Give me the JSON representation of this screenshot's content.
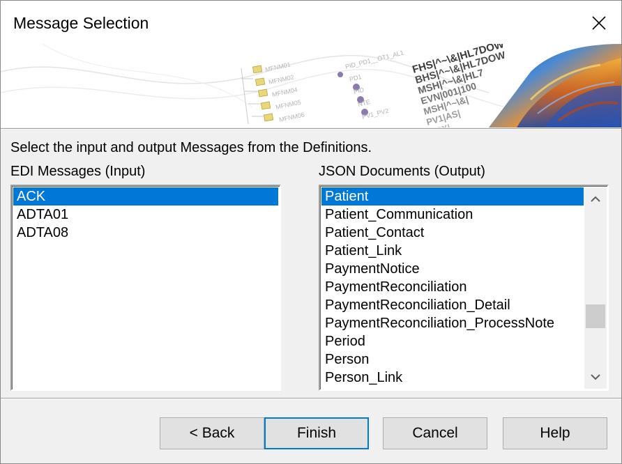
{
  "window": {
    "title": "Message Selection"
  },
  "instruction": "Select the input and output Messages from the Definitions.",
  "input": {
    "label": "EDI Messages (Input)",
    "items": [
      "ACK",
      "ADTA01",
      "ADTA08"
    ],
    "selected": "ACK"
  },
  "output": {
    "label": "JSON Documents (Output)",
    "items": [
      "Patient",
      "Patient_Communication",
      "Patient_Contact",
      "Patient_Link",
      "PaymentNotice",
      "PaymentReconciliation",
      "PaymentReconciliation_Detail",
      "PaymentReconciliation_ProcessNote",
      "Period",
      "Person",
      "Person_Link"
    ],
    "selected": "Patient"
  },
  "banner": {
    "tree_nodes": [
      "MFNM01",
      "MFNM02",
      "MFNM04",
      "MFNM05",
      "MFNM06"
    ],
    "segment_nodes": [
      "PID_PD1__OT1_AL1",
      "PD1",
      "PID",
      "NTE",
      "PV1_PV2"
    ],
    "code_lines": [
      "FHS|^~\\&|HL7DOW",
      "BHS|^~\\&|HL7DOW",
      "MSH|^~\\&|HL7",
      "EVN|001|100",
      "MSH|^~\\&|",
      "PV1|AS|",
      "OBX|"
    ]
  },
  "buttons": {
    "back": "< Back",
    "finish": "Finish",
    "cancel": "Cancel",
    "help": "Help"
  },
  "colors": {
    "selection": "#0078d7",
    "dialog_bg": "#f0f0f0",
    "button_bg": "#e1e1e1"
  }
}
